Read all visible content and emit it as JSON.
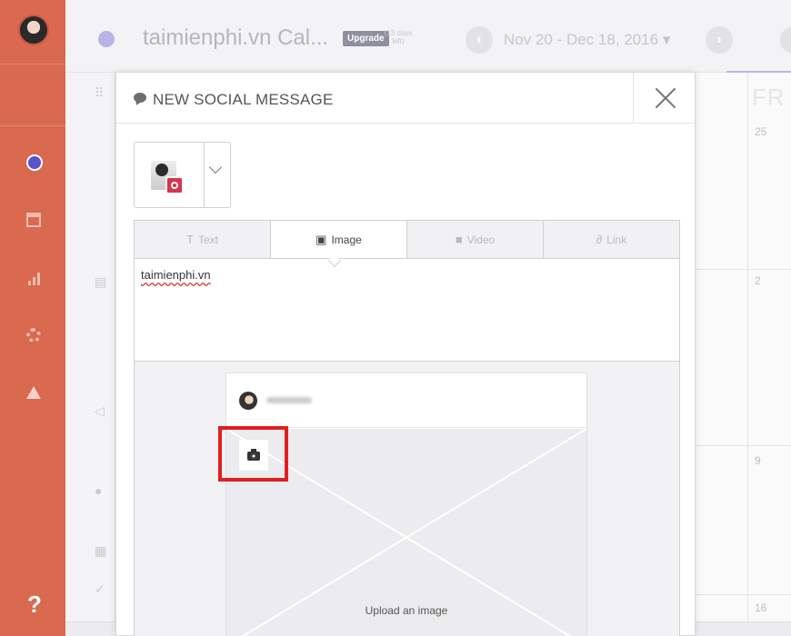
{
  "header": {
    "title": "taimienphi.vn Cal...",
    "upgrade": "Upgrade",
    "trial_text": "(13 days left)",
    "date_range": "Nov 20 - Dec 18, 2016 ▾",
    "prev_glyph": "‹",
    "next_glyph": "›"
  },
  "sidebar": {
    "help_label": "?",
    "icons": [
      "avatar",
      "calendar-icon",
      "analytics-icon",
      "settings-icon",
      "alert-icon"
    ]
  },
  "calendar": {
    "day_fr": "FR",
    "dates": [
      "25",
      "2",
      "9",
      "16"
    ]
  },
  "modal": {
    "title": "NEW SOCIAL MESSAGE",
    "tabs": [
      {
        "icon": "T",
        "label": "Text"
      },
      {
        "icon": "▣",
        "label": "Image"
      },
      {
        "icon": "■",
        "label": "Video"
      },
      {
        "icon": "∂",
        "label": "Link"
      }
    ],
    "message_text": "taimienphi.vn",
    "preview": {
      "upload_label": "Upload an image"
    }
  },
  "colors": {
    "sidebar": "#d9694f",
    "accent_purple": "#5a52c6",
    "highlight": "#e01f1f",
    "instagram": "#d8344f"
  }
}
